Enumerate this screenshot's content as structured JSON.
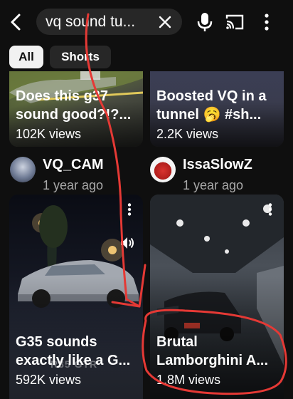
{
  "search": {
    "query": "vq sound tu..."
  },
  "chips": [
    {
      "label": "All"
    },
    {
      "label": "Shorts"
    }
  ],
  "top_cards": [
    {
      "title": "Does this g37\nsound good?!?...",
      "views": "102K views"
    },
    {
      "title": "Boosted VQ in a\ntunnel 🥱 #sh...",
      "views": "2.2K views"
    }
  ],
  "channels": [
    {
      "name": "VQ_CAM",
      "age": "1 year ago"
    },
    {
      "name": "IssaSlowZ",
      "age": "1 year ago"
    }
  ],
  "bottom_cards": [
    {
      "title": "G35 sounds\nexactly like a G...",
      "views": "592K views",
      "plate": "R35 GTR"
    },
    {
      "title": "Brutal\nLamborghini A...",
      "views": "1.8M views"
    }
  ],
  "icons": {
    "back": "arrow-left-icon",
    "clear": "close-icon",
    "mic": "microphone-icon",
    "cast": "cast-icon",
    "more": "more-vertical-icon",
    "volume": "speaker-icon"
  },
  "colors": {
    "annotation": "#e53935",
    "chip_active_bg": "#f1f1f1",
    "chip_bg": "#272727"
  }
}
